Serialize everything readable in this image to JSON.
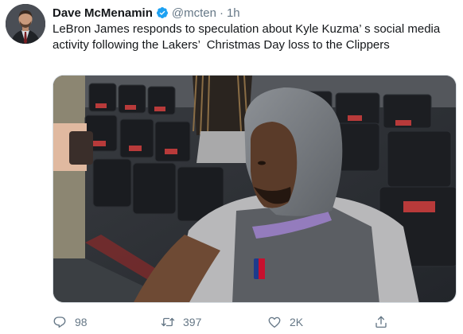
{
  "author": {
    "name": "Dave McMenamin",
    "handle": "@mcten",
    "separator": "·",
    "time": "1h",
    "verified": true
  },
  "tweet": {
    "text": "LeBron James responds to speculation about Kyle Kuzma’ s social media activity following the Lakers’  Christmas Day loss to the Clippers"
  },
  "actions": {
    "replies": "98",
    "retweets": "397",
    "likes": "2K"
  },
  "colors": {
    "verified_badge": "#1da1f2",
    "action_gray": "#657786",
    "text": "#14171a"
  }
}
